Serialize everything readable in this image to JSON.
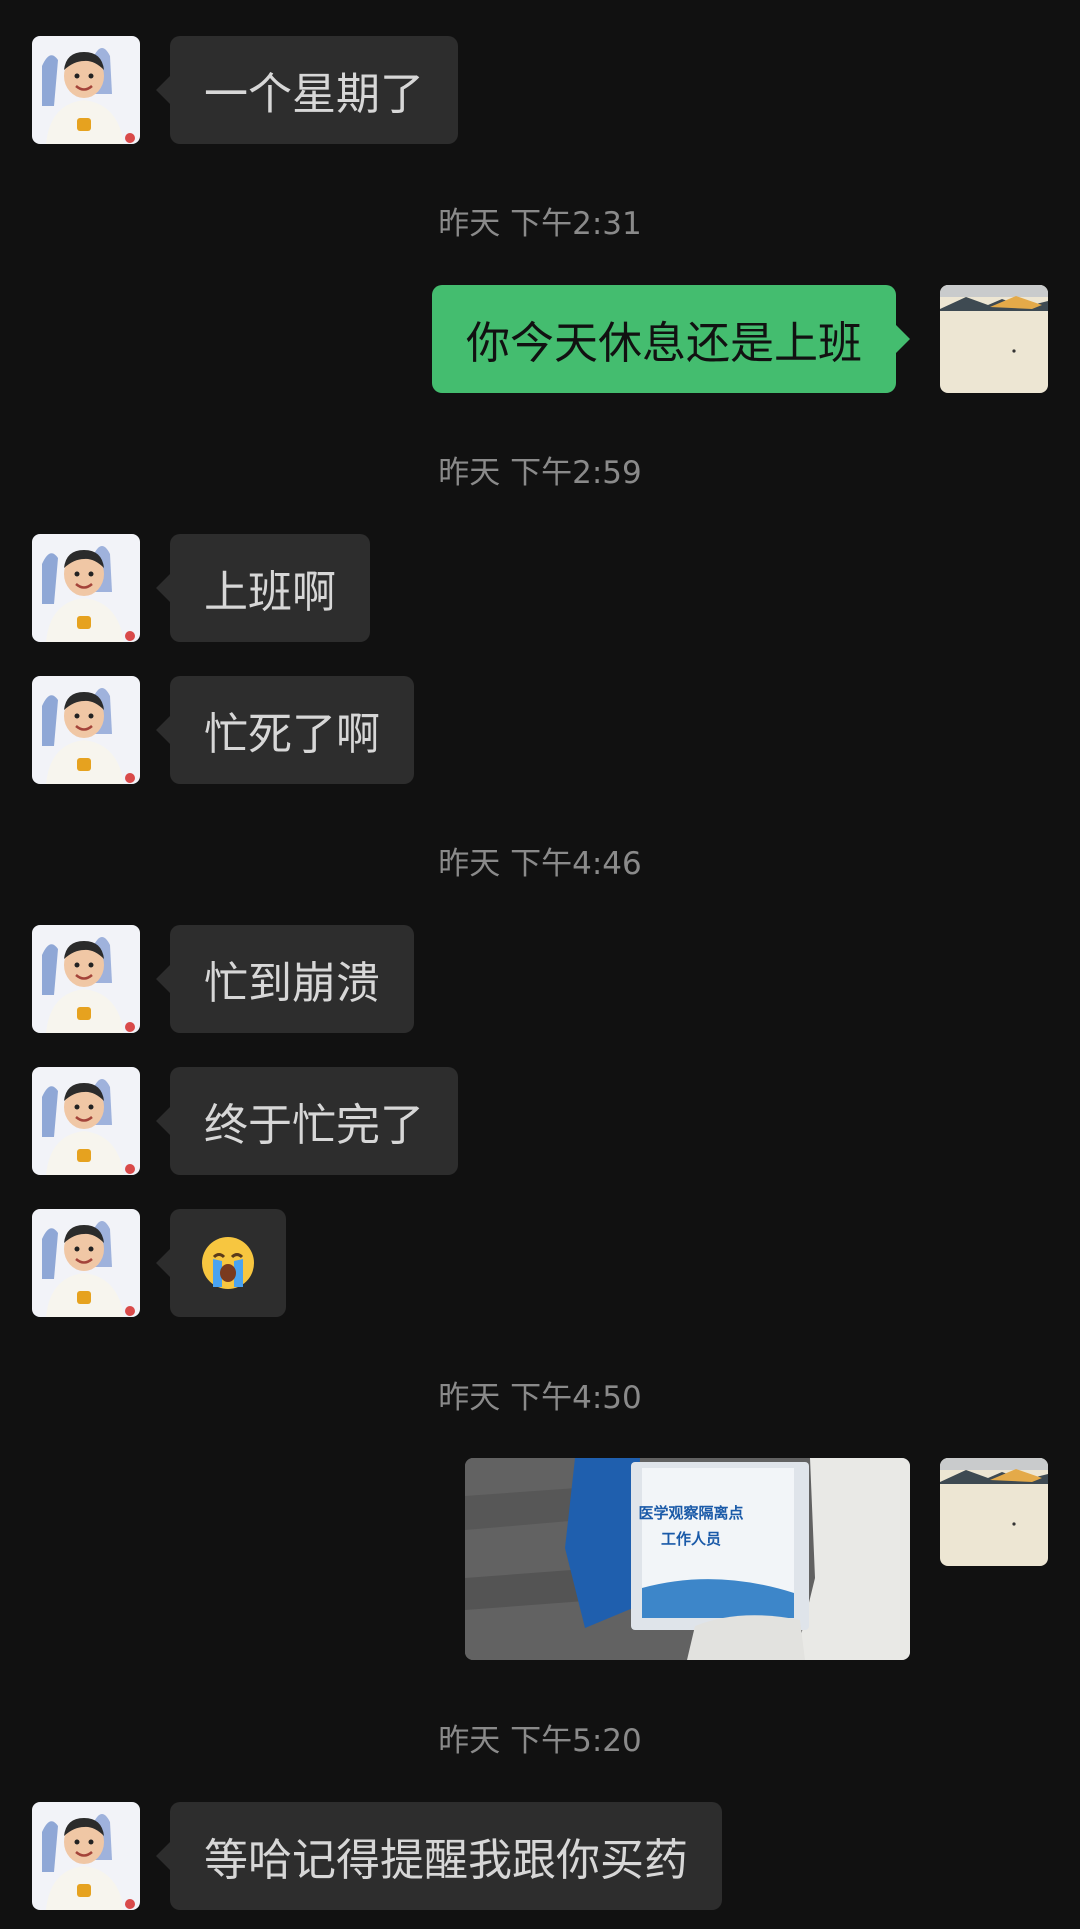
{
  "messages": [
    {
      "text": "一个星期了"
    },
    {
      "text": "你今天休息还是上班"
    },
    {
      "text": "上班啊"
    },
    {
      "text": "忙死了啊"
    },
    {
      "text": "忙到崩溃"
    },
    {
      "text": "终于忙完了"
    },
    {
      "emoji": "loudly-crying-face"
    },
    {
      "text": "等哈记得提醒我跟你买药"
    }
  ],
  "timestamps": [
    "昨天 下午2:31",
    "昨天 下午2:59",
    "昨天 下午4:46",
    "昨天 下午4:50",
    "昨天 下午5:20"
  ],
  "photo": {
    "card_title": "医学观察隔离点",
    "card_subtitle": "工作人员"
  },
  "colors": {
    "background": "#111111",
    "incoming_bubble": "#2d2d2d",
    "outgoing_bubble": "#44bd6f",
    "timestamp": "#8a8a8a"
  }
}
